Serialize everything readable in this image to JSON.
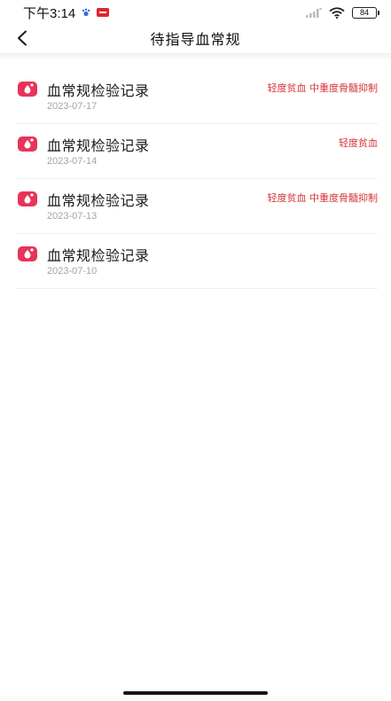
{
  "status_bar": {
    "time": "下午3:14",
    "battery_level": "84"
  },
  "nav": {
    "title": "待指导血常规"
  },
  "records": [
    {
      "title": "血常规检验记录",
      "date": "2023-07-17",
      "tags": "轻度贫血 中重度骨髓抑制"
    },
    {
      "title": "血常规检验记录",
      "date": "2023-07-14",
      "tags": "轻度贫血"
    },
    {
      "title": "血常规检验记录",
      "date": "2023-07-13",
      "tags": "轻度贫血 中重度骨髓抑制"
    },
    {
      "title": "血常规检验记录",
      "date": "2023-07-10",
      "tags": ""
    }
  ],
  "colors": {
    "accent": "#e8335a",
    "tag_text": "#d6333a"
  }
}
